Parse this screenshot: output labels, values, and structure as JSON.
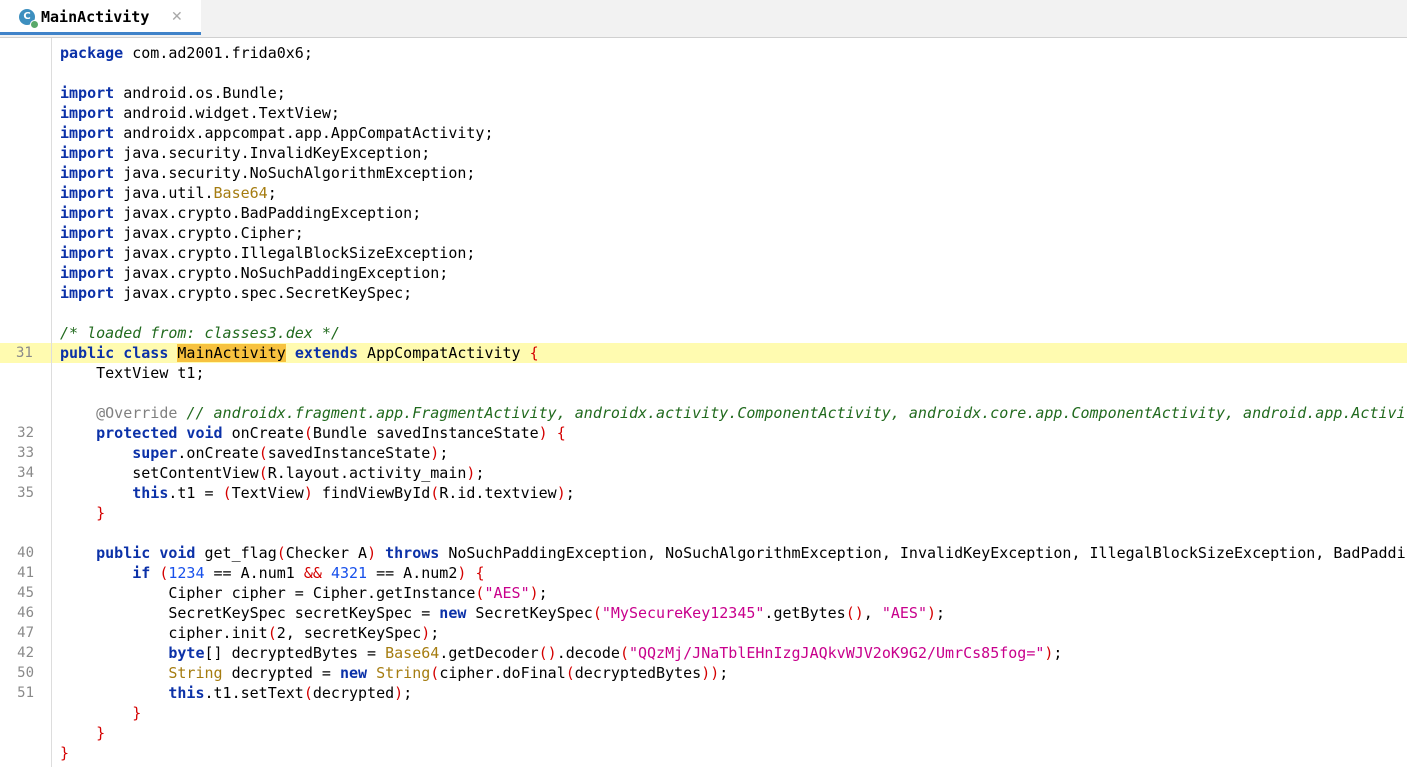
{
  "tab": {
    "icon_letter": "C",
    "title": "MainActivity",
    "close": "✕"
  },
  "gutter": [
    {
      "row": 15,
      "num": "31",
      "hl": true
    },
    {
      "row": 19,
      "num": "32"
    },
    {
      "row": 20,
      "num": "33"
    },
    {
      "row": 21,
      "num": "34"
    },
    {
      "row": 22,
      "num": "35"
    },
    {
      "row": 25,
      "num": "40"
    },
    {
      "row": 26,
      "num": "41"
    },
    {
      "row": 27,
      "num": "45"
    },
    {
      "row": 28,
      "num": "46"
    },
    {
      "row": 29,
      "num": "47"
    },
    {
      "row": 30,
      "num": "42"
    },
    {
      "row": 31,
      "num": "50"
    },
    {
      "row": 32,
      "num": "51"
    }
  ],
  "lines": [
    {
      "row": 0,
      "tokens": [
        [
          "kw",
          "package"
        ],
        [
          "plain",
          " com.ad2001.frida0x6;"
        ]
      ]
    },
    {
      "row": 2,
      "tokens": [
        [
          "kw",
          "import"
        ],
        [
          "plain",
          " android.os.Bundle;"
        ]
      ]
    },
    {
      "row": 3,
      "tokens": [
        [
          "kw",
          "import"
        ],
        [
          "plain",
          " android.widget.TextView;"
        ]
      ]
    },
    {
      "row": 4,
      "tokens": [
        [
          "kw",
          "import"
        ],
        [
          "plain",
          " androidx.appcompat.app.AppCompatActivity;"
        ]
      ]
    },
    {
      "row": 5,
      "tokens": [
        [
          "kw",
          "import"
        ],
        [
          "plain",
          " java.security.InvalidKeyException;"
        ]
      ]
    },
    {
      "row": 6,
      "tokens": [
        [
          "kw",
          "import"
        ],
        [
          "plain",
          " java.security.NoSuchAlgorithmException;"
        ]
      ]
    },
    {
      "row": 7,
      "tokens": [
        [
          "kw",
          "import"
        ],
        [
          "plain",
          " java.util."
        ],
        [
          "b64",
          "Base64"
        ],
        [
          "plain",
          ";"
        ]
      ]
    },
    {
      "row": 8,
      "tokens": [
        [
          "kw",
          "import"
        ],
        [
          "plain",
          " javax.crypto.BadPaddingException;"
        ]
      ]
    },
    {
      "row": 9,
      "tokens": [
        [
          "kw",
          "import"
        ],
        [
          "plain",
          " javax.crypto.Cipher;"
        ]
      ]
    },
    {
      "row": 10,
      "tokens": [
        [
          "kw",
          "import"
        ],
        [
          "plain",
          " javax.crypto.IllegalBlockSizeException;"
        ]
      ]
    },
    {
      "row": 11,
      "tokens": [
        [
          "kw",
          "import"
        ],
        [
          "plain",
          " javax.crypto.NoSuchPaddingException;"
        ]
      ]
    },
    {
      "row": 12,
      "tokens": [
        [
          "kw",
          "import"
        ],
        [
          "plain",
          " javax.crypto.spec.SecretKeySpec;"
        ]
      ]
    },
    {
      "row": 14,
      "tokens": [
        [
          "cmt",
          "/* loaded from: classes3.dex */"
        ]
      ]
    },
    {
      "row": 15,
      "hl": true,
      "tokens": [
        [
          "kw",
          "public class"
        ],
        [
          "plain",
          " "
        ],
        [
          "sel",
          "MainActivity"
        ],
        [
          "plain",
          " "
        ],
        [
          "kw",
          "extends"
        ],
        [
          "plain",
          " AppCompatActivity "
        ],
        [
          "br",
          "{"
        ]
      ]
    },
    {
      "row": 16,
      "tokens": [
        [
          "plain",
          "    TextView t1;"
        ]
      ]
    },
    {
      "row": 18,
      "tokens": [
        [
          "plain",
          "    "
        ],
        [
          "ann",
          "@Override"
        ],
        [
          "plain",
          " "
        ],
        [
          "cmt",
          "// androidx.fragment.app.FragmentActivity, androidx.activity.ComponentActivity, androidx.core.app.ComponentActivity, android.app.Activity"
        ]
      ]
    },
    {
      "row": 19,
      "tokens": [
        [
          "plain",
          "    "
        ],
        [
          "kw",
          "protected void"
        ],
        [
          "plain",
          " onCreate"
        ],
        [
          "br",
          "("
        ],
        [
          "plain",
          "Bundle savedInstanceState"
        ],
        [
          "br",
          ")"
        ],
        [
          "plain",
          " "
        ],
        [
          "br",
          "{"
        ]
      ]
    },
    {
      "row": 20,
      "tokens": [
        [
          "plain",
          "        "
        ],
        [
          "kw",
          "super"
        ],
        [
          "plain",
          ".onCreate"
        ],
        [
          "br",
          "("
        ],
        [
          "plain",
          "savedInstanceState"
        ],
        [
          "br",
          ")"
        ],
        [
          "plain",
          ";"
        ]
      ]
    },
    {
      "row": 21,
      "tokens": [
        [
          "plain",
          "        setContentView"
        ],
        [
          "br",
          "("
        ],
        [
          "plain",
          "R.layout.activity_main"
        ],
        [
          "br",
          ")"
        ],
        [
          "plain",
          ";"
        ]
      ]
    },
    {
      "row": 22,
      "tokens": [
        [
          "plain",
          "        "
        ],
        [
          "kw",
          "this"
        ],
        [
          "plain",
          ".t1 = "
        ],
        [
          "br",
          "("
        ],
        [
          "plain",
          "TextView"
        ],
        [
          "br",
          ")"
        ],
        [
          "plain",
          " findViewById"
        ],
        [
          "br",
          "("
        ],
        [
          "plain",
          "R.id.textview"
        ],
        [
          "br",
          ")"
        ],
        [
          "plain",
          ";"
        ]
      ]
    },
    {
      "row": 23,
      "tokens": [
        [
          "plain",
          "    "
        ],
        [
          "br",
          "}"
        ]
      ]
    },
    {
      "row": 25,
      "tokens": [
        [
          "plain",
          "    "
        ],
        [
          "kw",
          "public void"
        ],
        [
          "plain",
          " get_flag"
        ],
        [
          "br",
          "("
        ],
        [
          "plain",
          "Checker A"
        ],
        [
          "br",
          ")"
        ],
        [
          "plain",
          " "
        ],
        [
          "kw",
          "throws"
        ],
        [
          "plain",
          " NoSuchPaddingException, NoSuchAlgorithmException, InvalidKeyException, IllegalBlockSizeException, BadPaddingException "
        ],
        [
          "br",
          "{"
        ]
      ]
    },
    {
      "row": 26,
      "tokens": [
        [
          "plain",
          "        "
        ],
        [
          "kw",
          "if"
        ],
        [
          "plain",
          " "
        ],
        [
          "br",
          "("
        ],
        [
          "num",
          "1234"
        ],
        [
          "plain",
          " == A.num1 "
        ],
        [
          "br",
          "&&"
        ],
        [
          "plain",
          " "
        ],
        [
          "num",
          "4321"
        ],
        [
          "plain",
          " == A.num2"
        ],
        [
          "br",
          ")"
        ],
        [
          "plain",
          " "
        ],
        [
          "br",
          "{"
        ]
      ]
    },
    {
      "row": 27,
      "tokens": [
        [
          "plain",
          "            Cipher cipher = Cipher.getInstance"
        ],
        [
          "br",
          "("
        ],
        [
          "str2",
          "\"AES\""
        ],
        [
          "br",
          ")"
        ],
        [
          "plain",
          ";"
        ]
      ]
    },
    {
      "row": 28,
      "tokens": [
        [
          "plain",
          "            SecretKeySpec secretKeySpec = "
        ],
        [
          "kw",
          "new"
        ],
        [
          "plain",
          " SecretKeySpec"
        ],
        [
          "br",
          "("
        ],
        [
          "str2",
          "\"MySecureKey12345\""
        ],
        [
          "plain",
          ".getBytes"
        ],
        [
          "br",
          "()"
        ],
        [
          "plain",
          ", "
        ],
        [
          "str2",
          "\"AES\""
        ],
        [
          "br",
          ")"
        ],
        [
          "plain",
          ";"
        ]
      ]
    },
    {
      "row": 29,
      "tokens": [
        [
          "plain",
          "            cipher.init"
        ],
        [
          "br",
          "("
        ],
        [
          "plain",
          "2, secretKeySpec"
        ],
        [
          "br",
          ")"
        ],
        [
          "plain",
          ";"
        ]
      ]
    },
    {
      "row": 30,
      "tokens": [
        [
          "plain",
          "            "
        ],
        [
          "kw",
          "byte"
        ],
        [
          "plain",
          "[] decryptedBytes = "
        ],
        [
          "b64",
          "Base64"
        ],
        [
          "plain",
          ".getDecoder"
        ],
        [
          "br",
          "()"
        ],
        [
          "plain",
          ".decode"
        ],
        [
          "br",
          "("
        ],
        [
          "str2",
          "\"QQzMj/JNaTblEHnIzgJAQkvWJV2oK9G2/UmrCs85fog=\""
        ],
        [
          "br",
          ")"
        ],
        [
          "plain",
          ";"
        ]
      ]
    },
    {
      "row": 31,
      "tokens": [
        [
          "plain",
          "            "
        ],
        [
          "b64",
          "String"
        ],
        [
          "plain",
          " decrypted = "
        ],
        [
          "kw",
          "new"
        ],
        [
          "plain",
          " "
        ],
        [
          "b64",
          "String"
        ],
        [
          "br",
          "("
        ],
        [
          "plain",
          "cipher.doFinal"
        ],
        [
          "br",
          "("
        ],
        [
          "plain",
          "decryptedBytes"
        ],
        [
          "br",
          "))"
        ],
        [
          "plain",
          ";"
        ]
      ]
    },
    {
      "row": 32,
      "tokens": [
        [
          "plain",
          "            "
        ],
        [
          "kw",
          "this"
        ],
        [
          "plain",
          ".t1.setText"
        ],
        [
          "br",
          "("
        ],
        [
          "plain",
          "decrypted"
        ],
        [
          "br",
          ")"
        ],
        [
          "plain",
          ";"
        ]
      ]
    },
    {
      "row": 33,
      "tokens": [
        [
          "plain",
          "        "
        ],
        [
          "br",
          "}"
        ]
      ]
    },
    {
      "row": 34,
      "tokens": [
        [
          "plain",
          "    "
        ],
        [
          "br",
          "}"
        ]
      ]
    },
    {
      "row": 35,
      "tokens": [
        [
          "br",
          "}"
        ]
      ]
    }
  ]
}
